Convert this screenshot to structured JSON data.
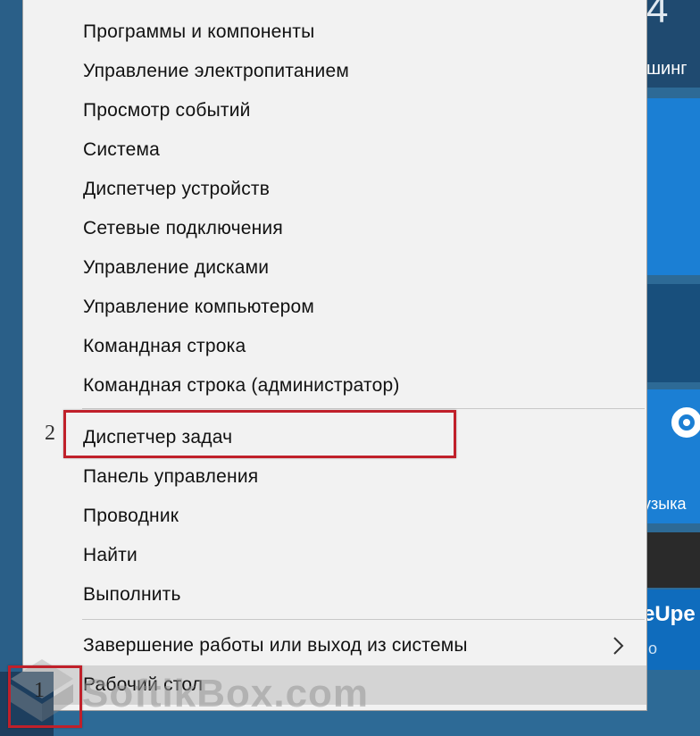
{
  "background_tiles": {
    "top_number": "4",
    "top_label": "шинг",
    "music_label": "узыка",
    "update_label": "eUpe",
    "small_label": "о"
  },
  "context_menu": {
    "items": [
      {
        "label": "Программы и компоненты"
      },
      {
        "label": "Управление электропитанием"
      },
      {
        "label": "Просмотр событий"
      },
      {
        "label": "Система"
      },
      {
        "label": "Диспетчер устройств"
      },
      {
        "label": "Сетевые подключения"
      },
      {
        "label": "Управление дисками"
      },
      {
        "label": "Управление компьютером"
      },
      {
        "label": "Командная строка"
      },
      {
        "label": "Командная строка (администратор)"
      },
      {
        "label": "Диспетчер задач"
      },
      {
        "label": "Панель управления"
      },
      {
        "label": "Проводник"
      },
      {
        "label": "Найти"
      },
      {
        "label": "Выполнить"
      }
    ],
    "shutdown_label": "Завершение работы или выход из системы",
    "desktop_label": "Рабочий стол"
  },
  "annotations": {
    "step_task_manager": "2",
    "step_start": "1",
    "color": "#c0202a"
  },
  "watermark": {
    "text": "SoftikBox.com"
  },
  "icons": {
    "submenu": "chevron-right-icon",
    "start": "windows-start-icon"
  }
}
